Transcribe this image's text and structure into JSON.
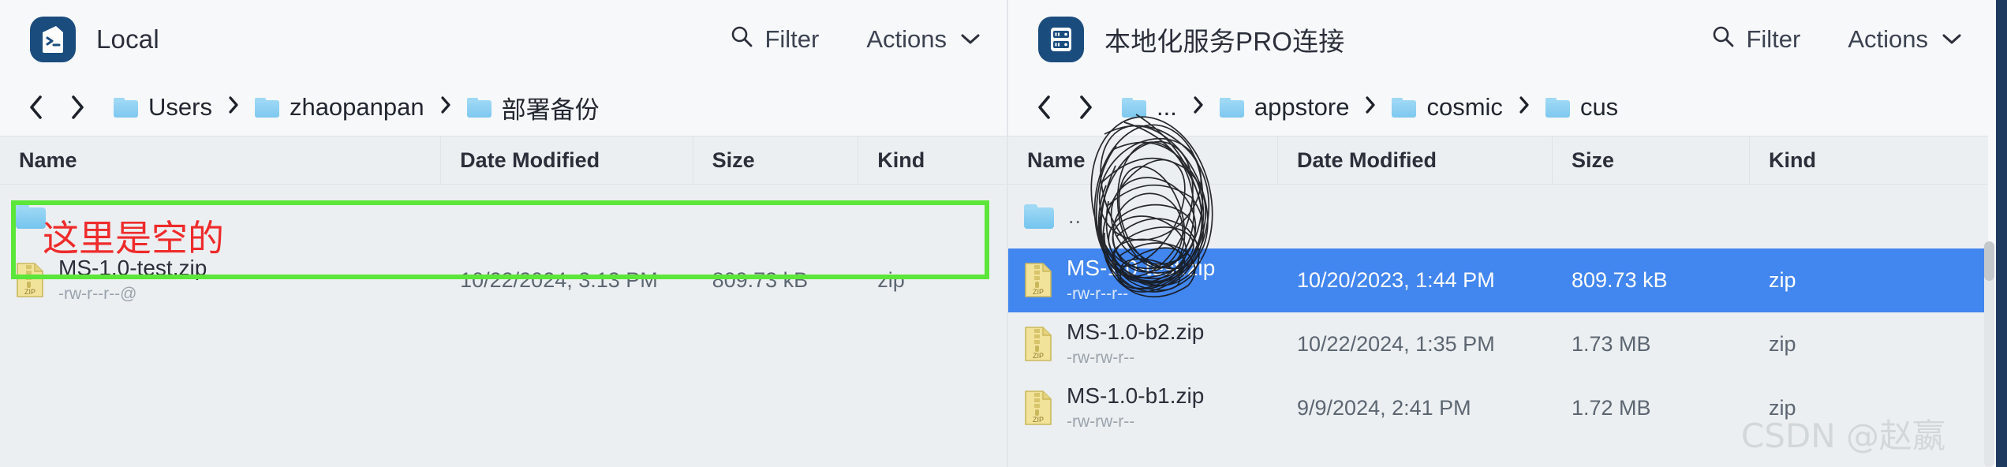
{
  "left_panel": {
    "app_icon": "terminal-icon",
    "title": "Local",
    "filter_label": "Filter",
    "filter_icon": "search-icon",
    "actions_label": "Actions",
    "actions_chevron": "⌄",
    "nav_back": "‹",
    "nav_forward": "›",
    "breadcrumbs": [
      "Users",
      "zhaopanpan",
      "部署备份"
    ],
    "crumb_separator": "›",
    "columns": [
      "Name",
      "Date Modified",
      "Size",
      "Kind"
    ],
    "rows": [
      {
        "icon": "folder-icon",
        "name": "..",
        "permissions": "",
        "date": "",
        "size": "",
        "kind": "",
        "selected": false,
        "parent": true
      },
      {
        "icon": "zip-file-icon",
        "name": "MS-1.0-test.zip",
        "permissions": "-rw-r--r--@",
        "date": "10/22/2024, 3:13 PM",
        "size": "809.73 kB",
        "kind": "zip",
        "selected": false,
        "parent": false
      }
    ]
  },
  "right_panel": {
    "app_icon": "server-icon",
    "title": "本地化服务PRO连接",
    "filter_label": "Filter",
    "filter_icon": "search-icon",
    "actions_label": "Actions",
    "actions_chevron": "⌄",
    "nav_back": "‹",
    "nav_forward": "›",
    "breadcrumbs": [
      "...",
      "appstore",
      "cosmic",
      "cus"
    ],
    "crumb_separator": "›",
    "columns": [
      "Name",
      "Date Modified",
      "Size",
      "Kind"
    ],
    "rows": [
      {
        "icon": "folder-icon",
        "name": "..",
        "permissions": "",
        "date": "",
        "size": "",
        "kind": "",
        "selected": false,
        "parent": true
      },
      {
        "icon": "zip-file-icon",
        "name": "MS-1.0-test.zip",
        "permissions": "-rw-r--r--",
        "date": "10/20/2023, 1:44 PM",
        "size": "809.73 kB",
        "kind": "zip",
        "selected": true,
        "parent": false
      },
      {
        "icon": "zip-file-icon",
        "name": "MS-1.0-b2.zip",
        "permissions": "-rw-rw-r--",
        "date": "10/22/2024, 1:35 PM",
        "size": "1.73 MB",
        "kind": "zip",
        "selected": false,
        "parent": false
      },
      {
        "icon": "zip-file-icon",
        "name": "MS-1.0-b1.zip",
        "permissions": "-rw-rw-r--",
        "date": "9/9/2024, 2:41 PM",
        "size": "1.72 MB",
        "kind": "zip",
        "selected": false,
        "parent": false
      }
    ]
  },
  "annotations": {
    "green_box_label": "empty-highlight-box",
    "red_note": "这里是空的",
    "scribble_label": "black-scribble-redaction"
  },
  "watermark": "CSDN @赵嬴",
  "colors": {
    "selection_blue": "#4286ef",
    "annotation_green": "#5ce63a",
    "annotation_red": "#ee2b2b",
    "app_icon_blue": "#1b4c7e",
    "panel_bg": "#eceff1",
    "header_bg": "#f6f8fa"
  }
}
